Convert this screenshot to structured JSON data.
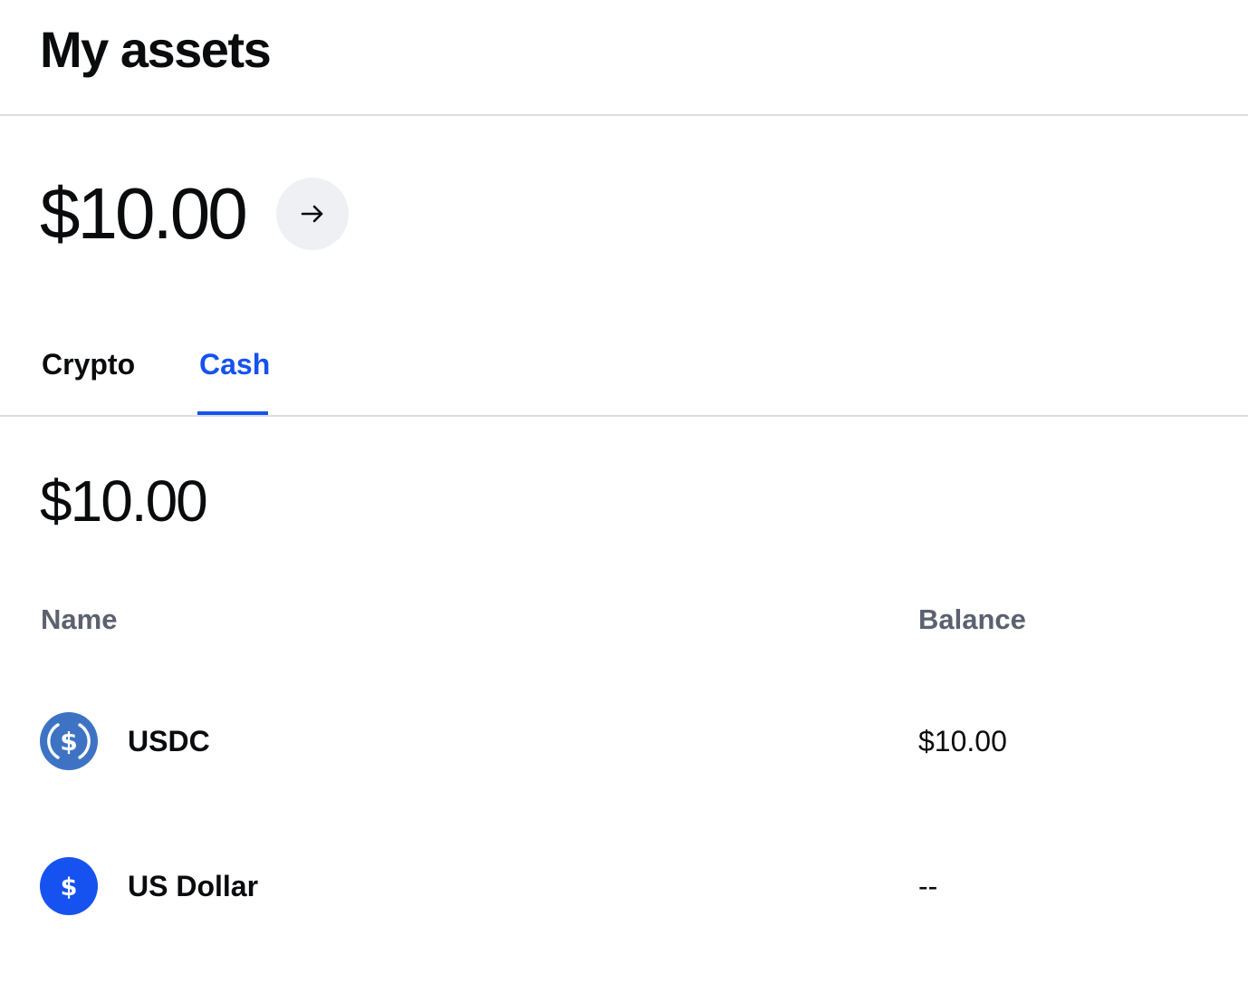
{
  "header": {
    "title": "My assets"
  },
  "summary": {
    "total": "$10.00",
    "arrow_icon": "arrow-right-icon"
  },
  "tabs": [
    {
      "label": "Crypto",
      "active": false
    },
    {
      "label": "Cash",
      "active": true
    }
  ],
  "cash": {
    "total": "$10.00",
    "columns": {
      "name": "Name",
      "balance": "Balance"
    },
    "assets": [
      {
        "name": "USDC",
        "balance": "$10.00",
        "icon": "usdc-icon",
        "icon_color": "#3e73c4"
      },
      {
        "name": "US Dollar",
        "balance": "--",
        "icon": "usd-icon",
        "icon_color": "#1652f0"
      }
    ]
  },
  "colors": {
    "accent": "#1652f0",
    "muted_text": "#5b616e",
    "divider": "#dcdde0",
    "button_bg": "#eef0f3"
  }
}
